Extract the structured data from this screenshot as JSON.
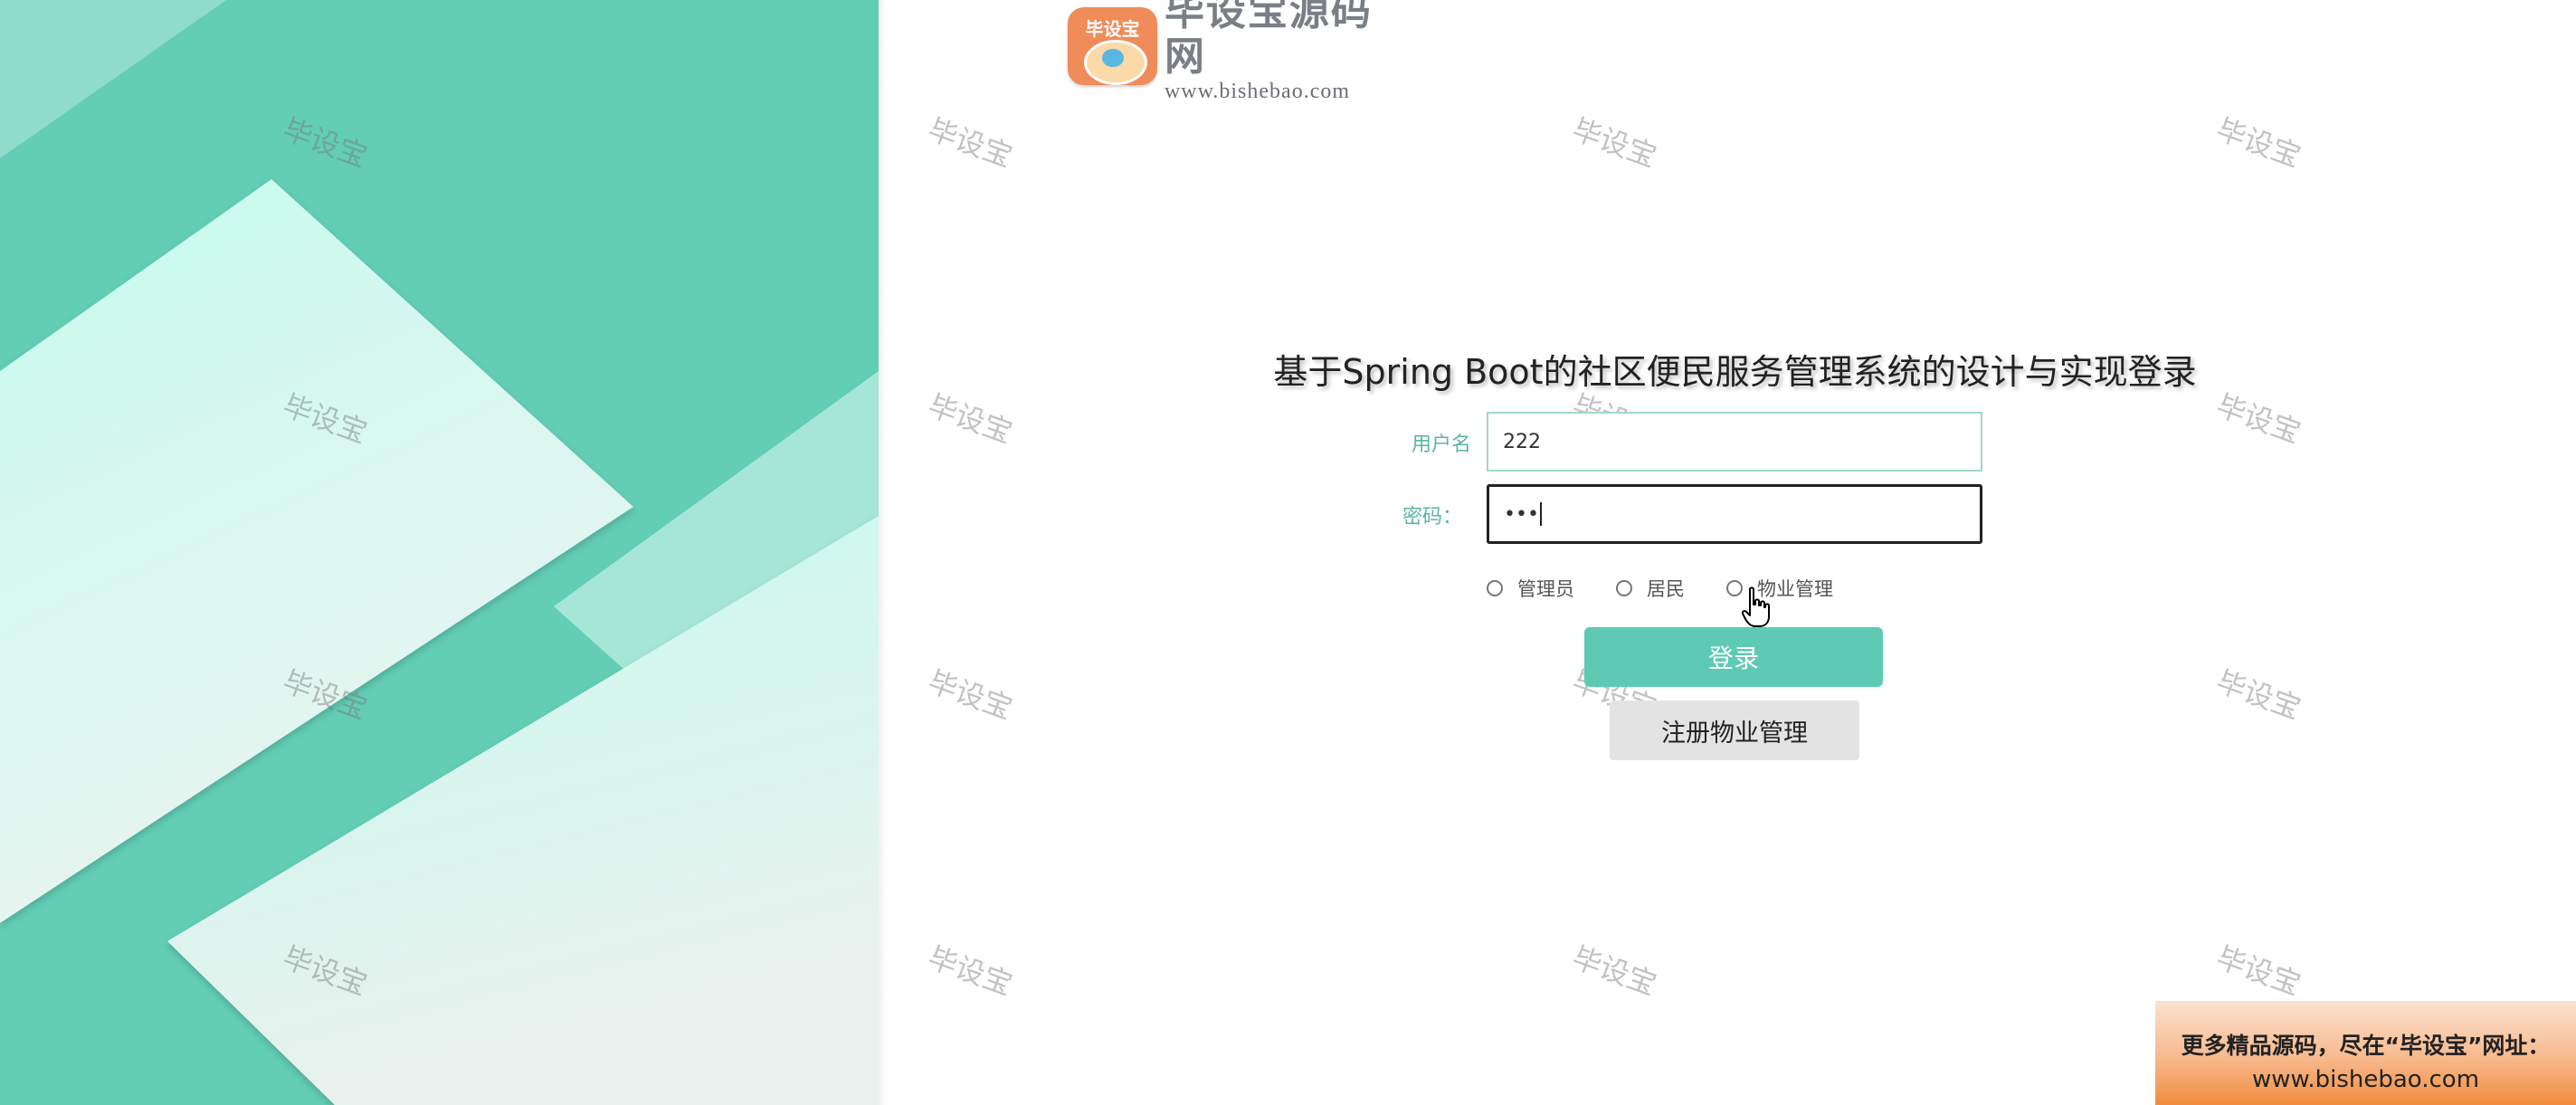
{
  "logo": {
    "badge_text": "毕设宝",
    "name": "毕设宝源码网",
    "url": "www.bishebao.com"
  },
  "watermark": {
    "text": "毕设宝"
  },
  "login": {
    "title": "基于Spring Boot的社区便民服务管理系统的设计与实现登录",
    "username_label": "用户名",
    "username_value": "222",
    "password_label": "密码：",
    "password_value": "•••",
    "roles": [
      {
        "label": "管理员",
        "selected": false
      },
      {
        "label": "居民",
        "selected": false
      },
      {
        "label": "物业管理",
        "selected": false
      }
    ],
    "login_button": "登录",
    "register_button": "注册物业管理"
  },
  "promo": {
    "line1": "更多精品源码，尽在“毕设宝”网址：",
    "line2": "www.bishebao.com"
  },
  "colors": {
    "accent": "#5ecab3",
    "panel_bg": "#63cdb6",
    "panel_light": "#c9fbef"
  }
}
